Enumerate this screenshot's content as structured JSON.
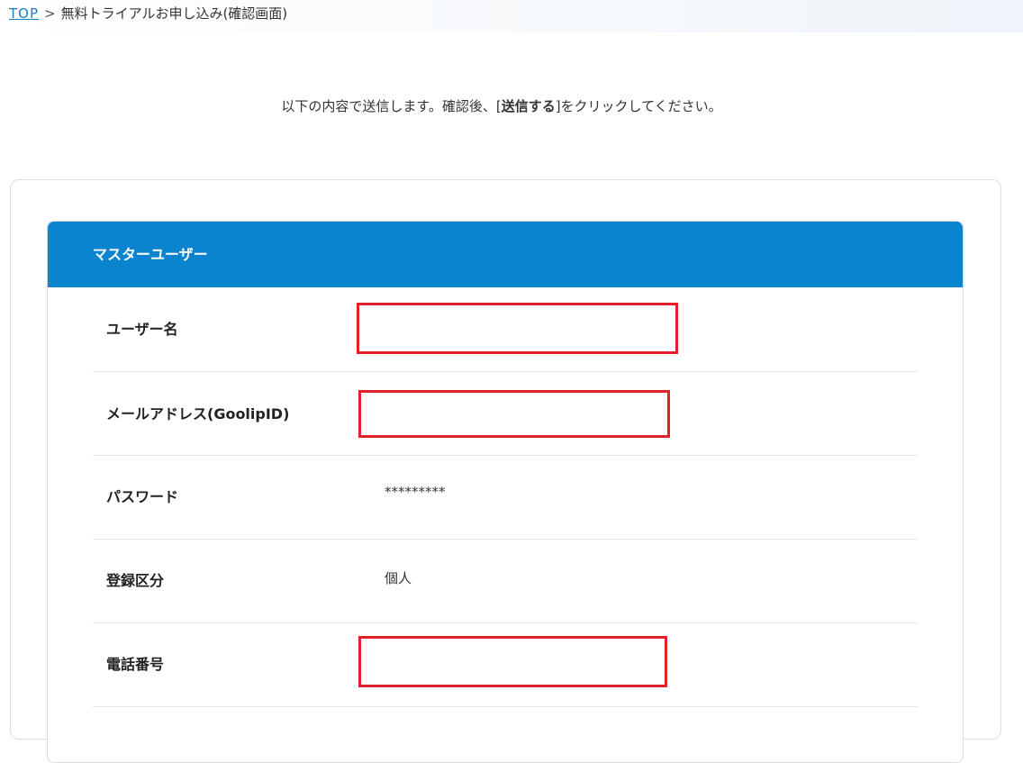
{
  "breadcrumb": {
    "home_link": "TOP",
    "separator": ">",
    "current": "無料トライアルお申し込み(確認画面)"
  },
  "intro": {
    "before": "以下の内容で送信します。確認後、[",
    "emphasis": "送信する",
    "after": "]をクリックしてください。"
  },
  "section": {
    "title": "マスターユーザー",
    "rows": [
      {
        "label": "ユーザー名",
        "value": ""
      },
      {
        "label": "メールアドレス(GoolipID)",
        "value": ""
      },
      {
        "label": "パスワード",
        "value": "*********"
      },
      {
        "label": "登録区分",
        "value": "個人"
      },
      {
        "label": "電話番号",
        "value": ""
      }
    ]
  },
  "colors": {
    "header_blue": "#0a84cf",
    "link_blue": "#1a7fc4",
    "redaction_red": "#e0202a"
  }
}
